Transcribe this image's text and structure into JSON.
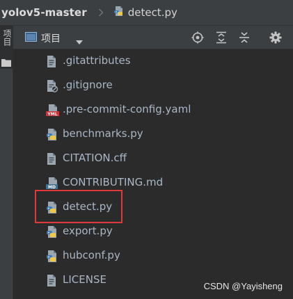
{
  "breadcrumb": {
    "project": "yolov5-master",
    "file": "detect.py",
    "separator_icon": "chevron-right-icon"
  },
  "side_stripe": {
    "tab_label": "项目",
    "icon": "folder-icon"
  },
  "tool_window": {
    "title": "项目",
    "view_icon": "project-view-icon",
    "dropdown_icon": "caret-down-icon",
    "tools": [
      "locate-icon",
      "expand-all-icon",
      "collapse-all-icon",
      "gear-icon"
    ]
  },
  "files": [
    {
      "name": ".gitattributes",
      "icon": "text-file-icon"
    },
    {
      "name": ".gitignore",
      "icon": "ignore-file-icon"
    },
    {
      "name": ".pre-commit-config.yaml",
      "icon": "yaml-file-icon"
    },
    {
      "name": "benchmarks.py",
      "icon": "python-file-icon"
    },
    {
      "name": "CITATION.cff",
      "icon": "text-file-icon"
    },
    {
      "name": "CONTRIBUTING.md",
      "icon": "markdown-file-icon"
    },
    {
      "name": "detect.py",
      "icon": "python-file-icon",
      "highlighted": true
    },
    {
      "name": "export.py",
      "icon": "python-file-icon"
    },
    {
      "name": "hubconf.py",
      "icon": "python-file-icon"
    },
    {
      "name": "LICENSE",
      "icon": "text-file-icon"
    }
  ],
  "colors": {
    "background": "#2b2b2b",
    "panel": "#3c3f41",
    "text": "#a9b7c6",
    "highlight_border": "#e03a3a"
  },
  "watermark": "CSDN @Yayisheng"
}
